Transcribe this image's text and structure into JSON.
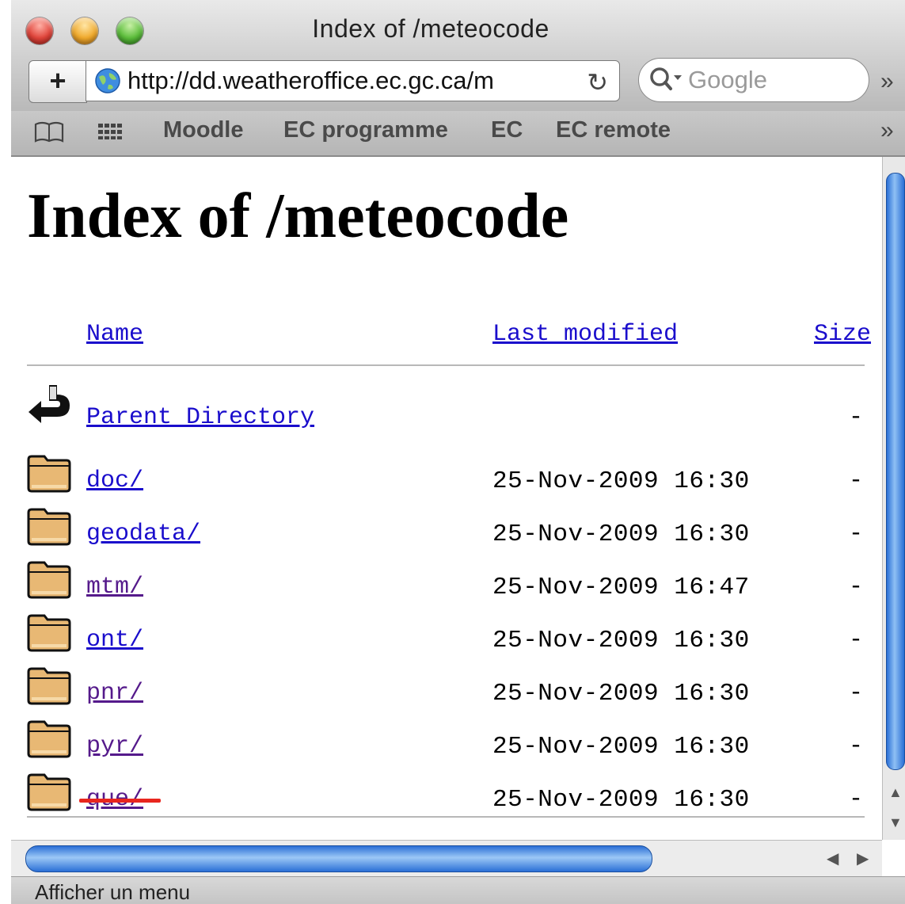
{
  "window": {
    "title": "Index of /meteocode"
  },
  "toolbar": {
    "add_label": "+",
    "url": "http://dd.weatheroffice.ec.gc.ca/m",
    "search_placeholder": "Google"
  },
  "bookmarks": {
    "items": [
      {
        "label": "Moodle"
      },
      {
        "label": "EC programme"
      },
      {
        "label": "EC"
      },
      {
        "label": "EC remote"
      }
    ]
  },
  "page": {
    "title": "Index of /meteocode",
    "columns": {
      "name": "Name",
      "last_modified": "Last modified",
      "size": "Size"
    },
    "rows": [
      {
        "name": "Parent Directory",
        "date": "",
        "size": "-",
        "icon": "back-arrow-icon",
        "visited": false
      },
      {
        "name": "doc/",
        "date": "25-Nov-2009 16:30",
        "size": "-",
        "icon": "folder-icon",
        "visited": false
      },
      {
        "name": "geodata/",
        "date": "25-Nov-2009 16:30",
        "size": "-",
        "icon": "folder-icon",
        "visited": false
      },
      {
        "name": "mtm/",
        "date": "25-Nov-2009 16:47",
        "size": "-",
        "icon": "folder-icon",
        "visited": true
      },
      {
        "name": "ont/",
        "date": "25-Nov-2009 16:30",
        "size": "-",
        "icon": "folder-icon",
        "visited": false
      },
      {
        "name": "pnr/",
        "date": "25-Nov-2009 16:30",
        "size": "-",
        "icon": "folder-icon",
        "visited": true
      },
      {
        "name": "pyr/",
        "date": "25-Nov-2009 16:30",
        "size": "-",
        "icon": "folder-icon",
        "visited": true
      },
      {
        "name": "que/",
        "date": "25-Nov-2009 16:30",
        "size": "-",
        "icon": "folder-icon",
        "visited": true
      }
    ]
  },
  "status": {
    "text": "Afficher un menu"
  },
  "colors": {
    "link": "#1a0dcc",
    "visited": "#551a8b",
    "annotation": "#e8261e"
  }
}
